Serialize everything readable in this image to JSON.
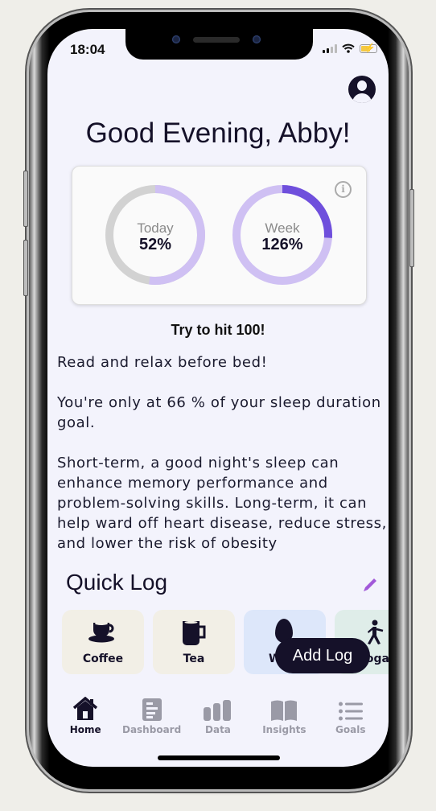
{
  "status_bar": {
    "time": "18:04",
    "signal_icon": "cellular-signal-icon",
    "wifi_icon": "wifi-icon",
    "battery_icon": "battery-charging-icon"
  },
  "header": {
    "profile_icon": "person-circle-icon",
    "greeting": "Good Evening, Abby!"
  },
  "progress_card": {
    "info_icon": "info-icon",
    "info_glyph": "i",
    "rings": [
      {
        "title": "Today",
        "value_label": "52%",
        "percent": 52
      },
      {
        "title": "Week",
        "value_label": "126%",
        "percent": 126
      }
    ],
    "colors": {
      "track_gray": "#d2d2d2",
      "fill_light": "#cfc0f3",
      "fill_dark": "#6f4fdc"
    }
  },
  "hint": "Try to hit 100!",
  "tips": [
    "Read and relax before bed!",
    "You're only at 66 % of your sleep duration goal.",
    "Short-term, a good night's sleep can enhance memory performance and problem-solving skills. Long-term, it can help ward off heart disease, reduce stress, and lower the risk of obesity"
  ],
  "quick_log": {
    "title": "Quick Log",
    "edit_icon": "pencil-icon",
    "items": [
      {
        "label": "Coffee",
        "icon": "coffee-cup-icon",
        "color": "#f2efe6"
      },
      {
        "label": "Tea",
        "icon": "mug-icon",
        "color": "#f2efe6"
      },
      {
        "label": "W",
        "icon": "water-drop-icon",
        "color": "#dde7fa"
      },
      {
        "label": "Yoga",
        "icon": "walking-figure-icon",
        "color": "#dfede9"
      }
    ],
    "add_button": "Add Log"
  },
  "tabbar": {
    "tabs": [
      {
        "label": "Home",
        "icon": "home-icon",
        "active": true
      },
      {
        "label": "Dashboard",
        "icon": "dashboard-icon",
        "active": false
      },
      {
        "label": "Data",
        "icon": "bar-chart-icon",
        "active": false
      },
      {
        "label": "Insights",
        "icon": "book-icon",
        "active": false
      },
      {
        "label": "Goals",
        "icon": "list-icon",
        "active": false
      }
    ]
  }
}
